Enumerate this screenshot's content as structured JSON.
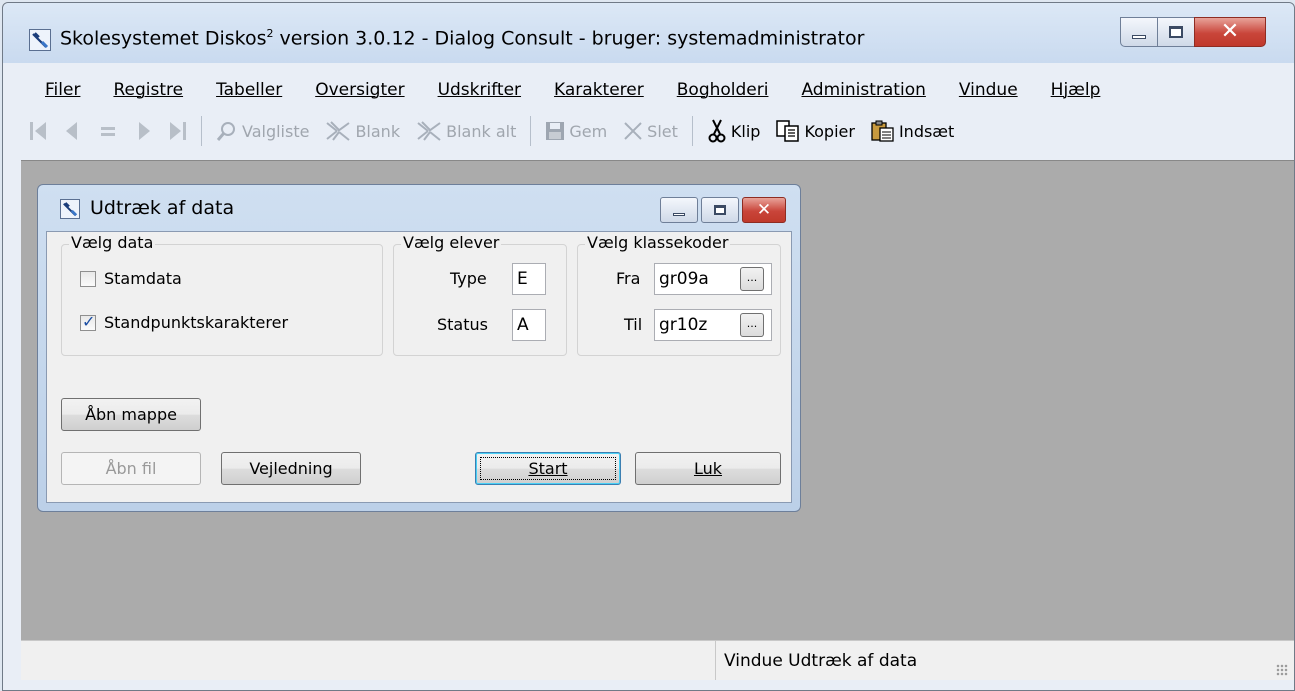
{
  "window": {
    "title_main": "Skolesystemet Diskos",
    "title_sup": "2",
    "title_rest": " version 3.0.12 - Dialog Consult - bruger: systemadministrator",
    "caption_buttons": [
      "minimize-icon",
      "maximize-icon",
      "close-icon"
    ]
  },
  "menu": [
    "Filer",
    "Registre",
    "Tabeller",
    "Oversigter",
    "Udskrifter",
    "Karakterer",
    "Bogholderi",
    "Administration",
    "Vindue",
    "Hjælp"
  ],
  "toolbar": {
    "first_icon": "first-record-icon",
    "prev_icon": "previous-record-icon",
    "equal_icon": "current-record-icon",
    "next_icon": "next-record-icon",
    "last_icon": "last-record-icon",
    "valgliste": "Valgliste",
    "blank": "Blank",
    "blank_alt": "Blank alt",
    "gem": "Gem",
    "slet": "Slet",
    "klip": "Klip",
    "kopier": "Kopier",
    "indsaet": "Indsæt"
  },
  "dialog": {
    "title": "Udtræk af data",
    "groups": {
      "data": {
        "title": "Vælg data",
        "stamdata": "Stamdata",
        "stamdata_checked": false,
        "standpunkt": "Standpunktskarakterer",
        "standpunkt_checked": true
      },
      "elever": {
        "title": "Vælg elever",
        "type_label": "Type",
        "type_value": "E",
        "status_label": "Status",
        "status_value": "A"
      },
      "klasse": {
        "title": "Vælg klassekoder",
        "fra_label": "Fra",
        "fra_value": "gr09a",
        "til_label": "Til",
        "til_value": "gr10z",
        "browse": "..."
      }
    },
    "buttons": {
      "abn_mappe": "Åbn mappe",
      "abn_fil": "Åbn fil",
      "vejledning": "Vejledning",
      "start": "Start",
      "luk": "Luk"
    }
  },
  "status": {
    "text": "Vindue Udtræk af data"
  }
}
